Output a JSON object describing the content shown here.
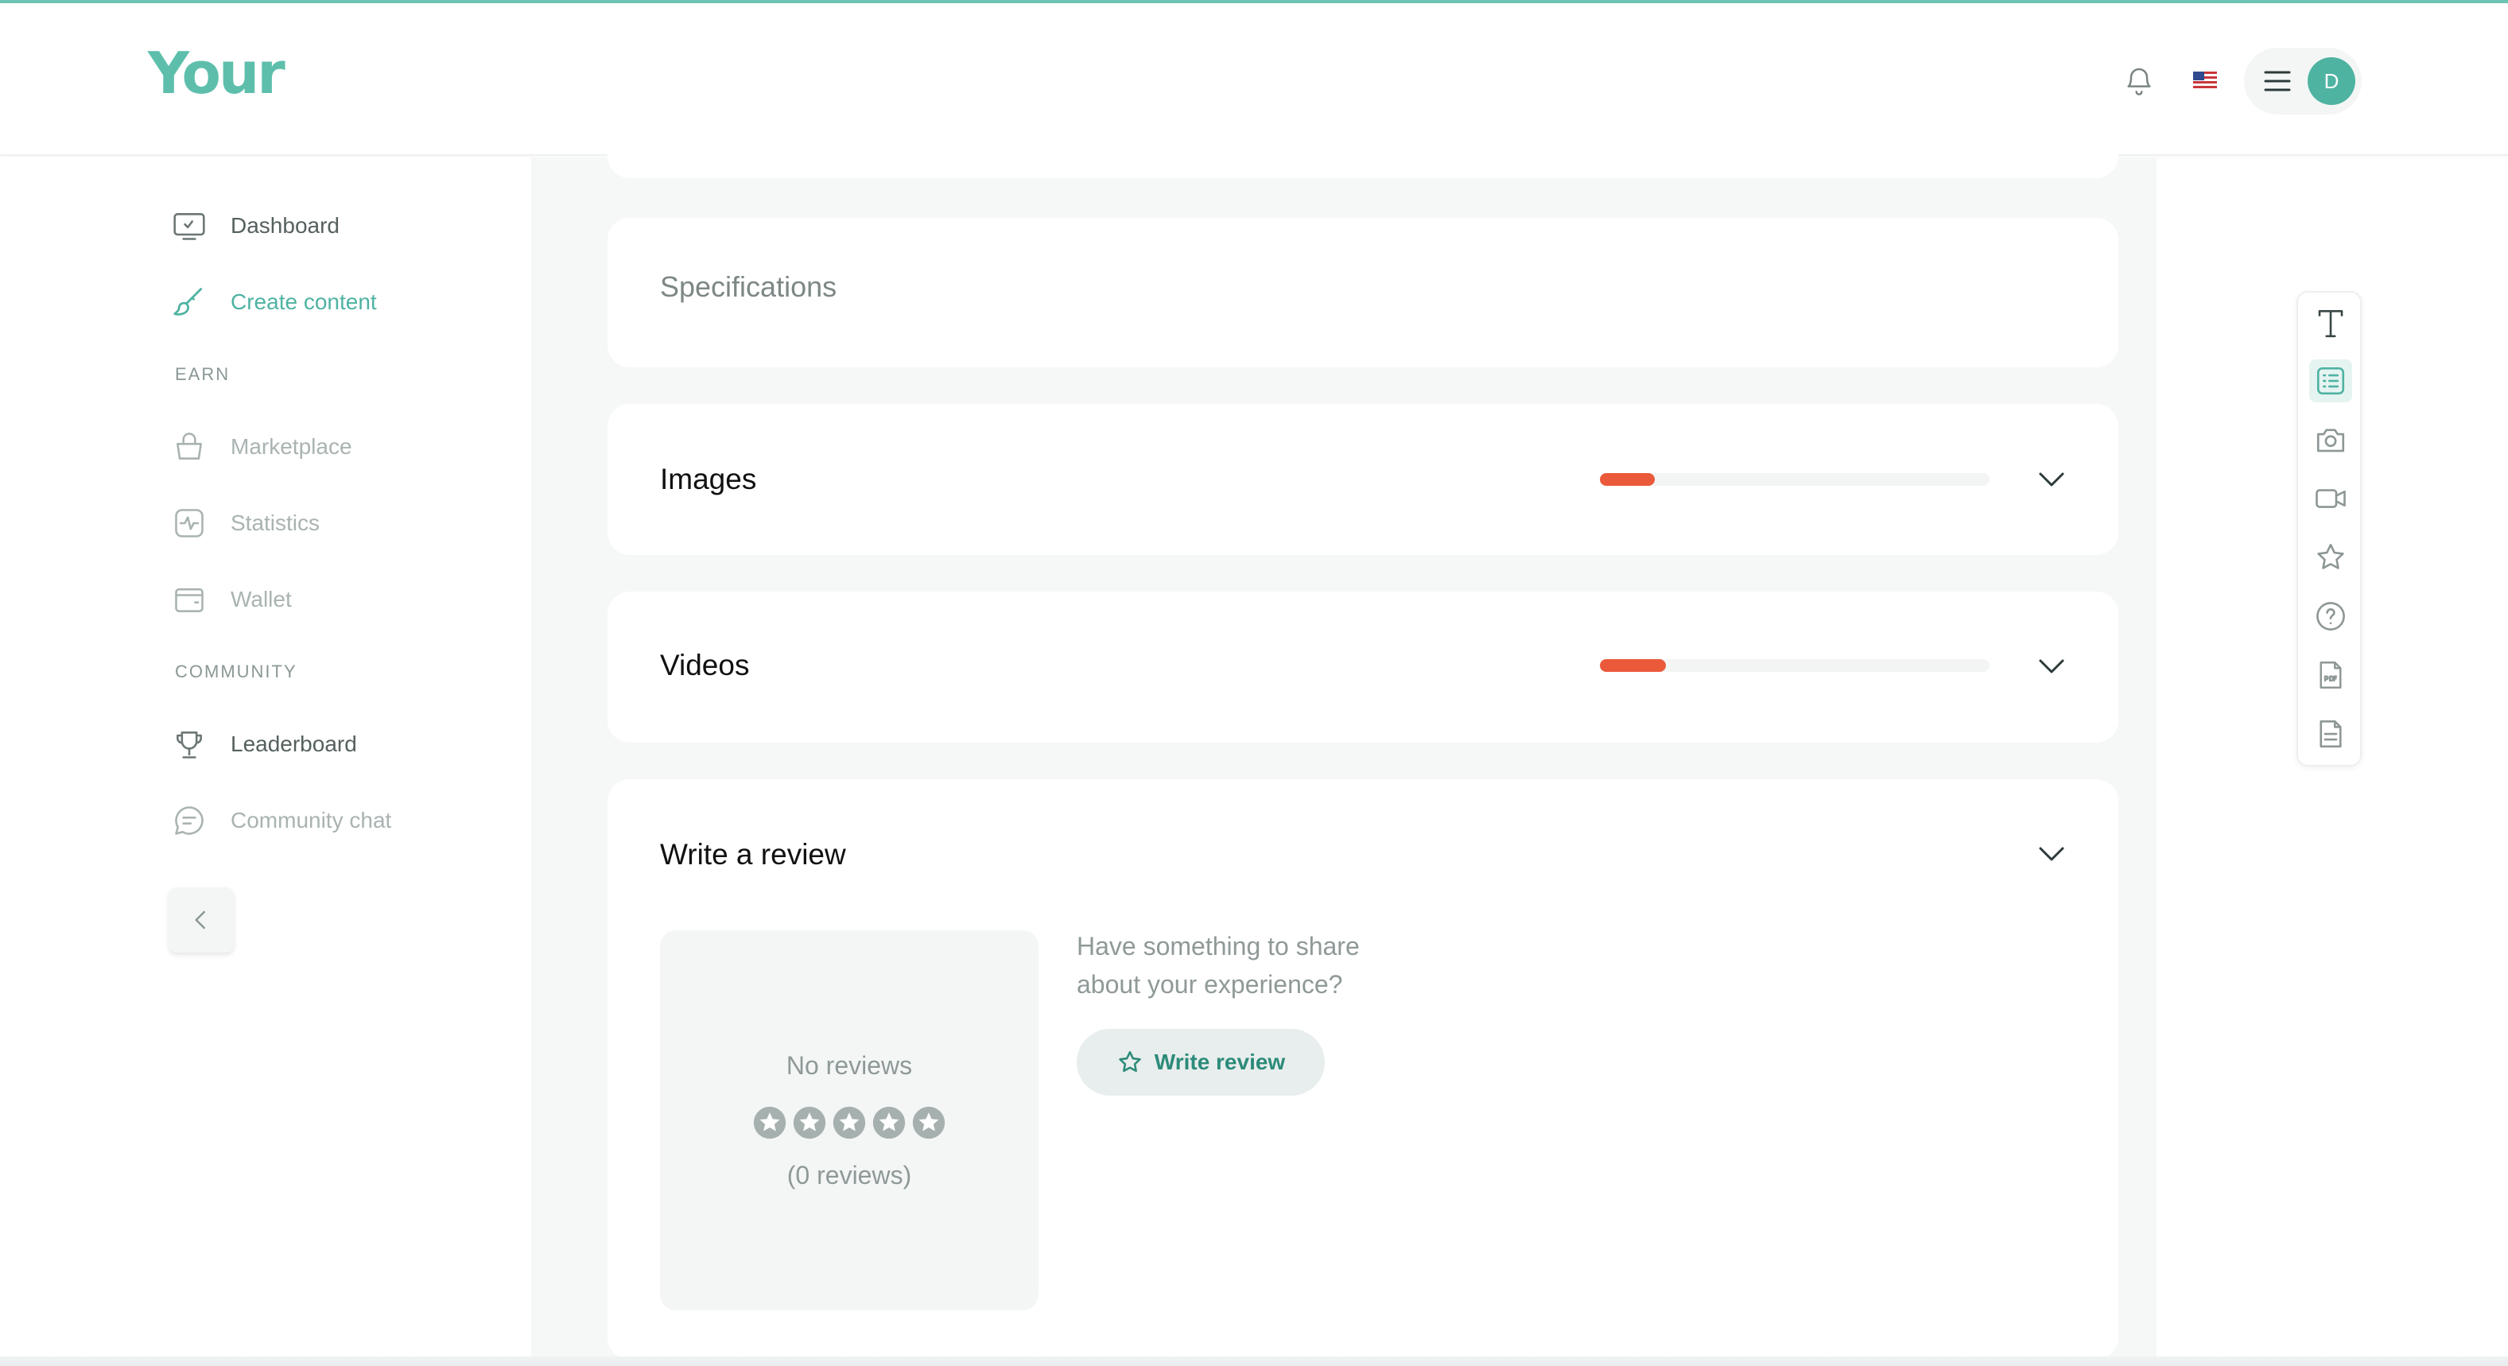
{
  "header": {
    "logo_text": "Your",
    "user_initial": "D"
  },
  "sidebar": {
    "items": [
      {
        "label": "Dashboard",
        "icon": "dashboard-icon"
      },
      {
        "label": "Create content",
        "icon": "brush-icon"
      },
      {
        "label": "Marketplace",
        "icon": "basket-icon"
      },
      {
        "label": "Statistics",
        "icon": "activity-icon"
      },
      {
        "label": "Wallet",
        "icon": "wallet-icon"
      },
      {
        "label": "Leaderboard",
        "icon": "trophy-icon"
      },
      {
        "label": "Community chat",
        "icon": "chat-icon"
      }
    ],
    "sections": {
      "earn": "EARN",
      "community": "COMMUNITY"
    }
  },
  "main": {
    "specifications_title": "Specifications",
    "images": {
      "title": "Images",
      "progress": 0.14
    },
    "videos": {
      "title": "Videos",
      "progress": 0.17
    },
    "review": {
      "title": "Write a review",
      "no_reviews": "No reviews",
      "count": "(0 reviews)",
      "prompt_line1": "Have something to share",
      "prompt_line2": "about your experience?",
      "button_label": "Write review"
    }
  },
  "colors": {
    "accent": "#4fb3a2",
    "progress": "#ea5a3a"
  },
  "toolbar": {
    "tools": [
      "text-icon",
      "list-icon",
      "camera-icon",
      "video-icon",
      "star-icon",
      "help-icon",
      "pdf-icon",
      "document-icon"
    ]
  }
}
